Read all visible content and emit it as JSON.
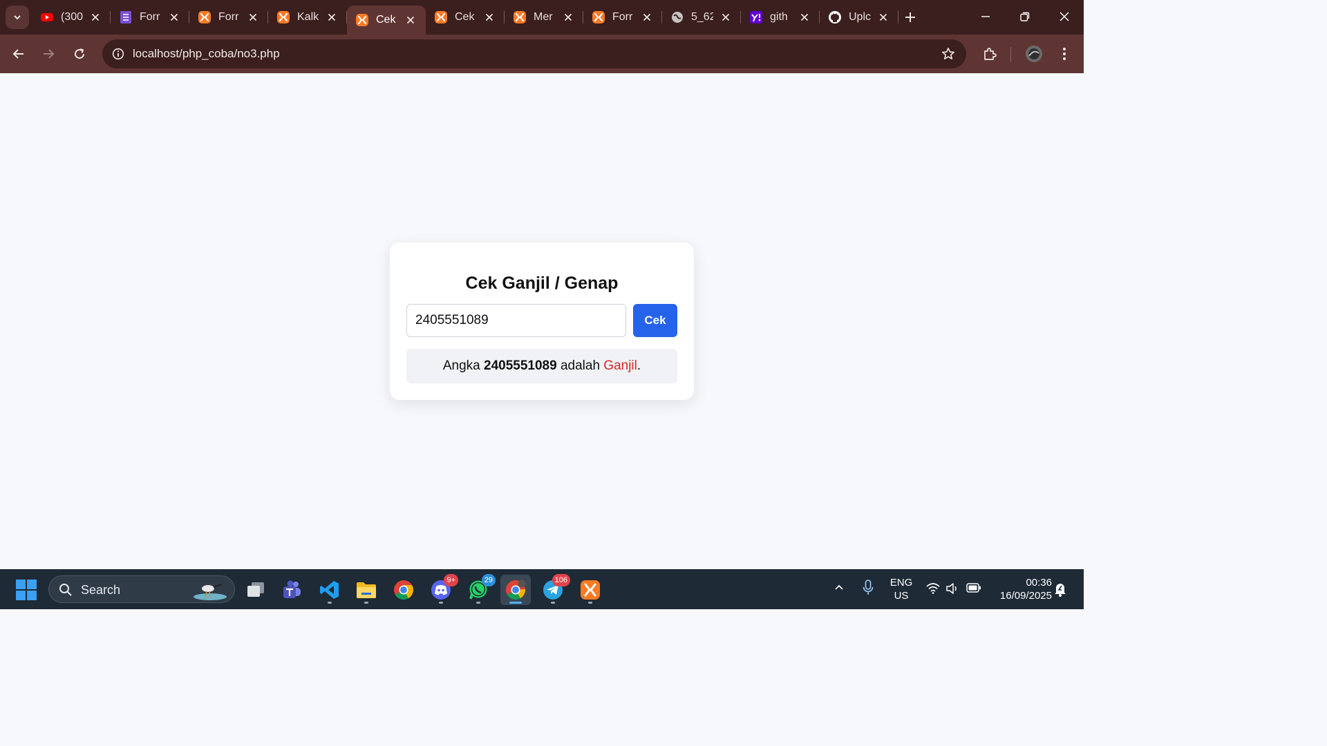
{
  "browser": {
    "tabs": [
      {
        "title": "(300",
        "icon": "youtube-icon",
        "color": "#ff0000"
      },
      {
        "title": "Forr",
        "icon": "forms-icon",
        "color": "#7b4fd6"
      },
      {
        "title": "Forr",
        "icon": "xampp-icon",
        "color": "#fb7a24"
      },
      {
        "title": "Kalk",
        "icon": "xampp-icon",
        "color": "#fb7a24"
      },
      {
        "title": "Cek",
        "icon": "xampp-icon",
        "color": "#fb7a24",
        "active": true
      },
      {
        "title": "Cek",
        "icon": "xampp-icon",
        "color": "#fb7a24"
      },
      {
        "title": "Mer",
        "icon": "xampp-icon",
        "color": "#fb7a24"
      },
      {
        "title": "Forr",
        "icon": "xampp-icon",
        "color": "#fb7a24"
      },
      {
        "title": "5_62",
        "icon": "globe-icon",
        "color": "#c9c2c2"
      },
      {
        "title": "gith",
        "icon": "yahoo-icon",
        "color": "#6001d2"
      },
      {
        "title": "Uplc",
        "icon": "github-icon",
        "color": "#ffffff"
      }
    ],
    "url": "localhost/php_coba/no3.php"
  },
  "page": {
    "heading": "Cek Ganjil / Genap",
    "input_value": "2405551089",
    "button_label": "Cek",
    "result": {
      "prefix": "Angka ",
      "number": "2405551089",
      "middle": " adalah ",
      "verdict": "Ganjil",
      "suffix": "."
    }
  },
  "taskbar": {
    "search_label": "Search",
    "apps": [
      {
        "name": "task-view",
        "running": false
      },
      {
        "name": "teams",
        "running": false
      },
      {
        "name": "vscode",
        "running": true
      },
      {
        "name": "file-explorer",
        "running": true
      },
      {
        "name": "chrome",
        "running": false
      },
      {
        "name": "discord",
        "running": true,
        "badge": "9+"
      },
      {
        "name": "whatsapp",
        "running": true,
        "badge": "29"
      },
      {
        "name": "chrome-profile",
        "running": true,
        "active": true
      },
      {
        "name": "telegram",
        "running": true,
        "badge": "106"
      },
      {
        "name": "xampp",
        "running": true
      }
    ],
    "lang_line1": "ENG",
    "lang_line2": "US",
    "time": "00:36",
    "date": "16/09/2025"
  },
  "colors": {
    "accent_button": "#2563eb",
    "verdict_text": "#dc2626",
    "browser_frame": "#3a1f1e"
  }
}
